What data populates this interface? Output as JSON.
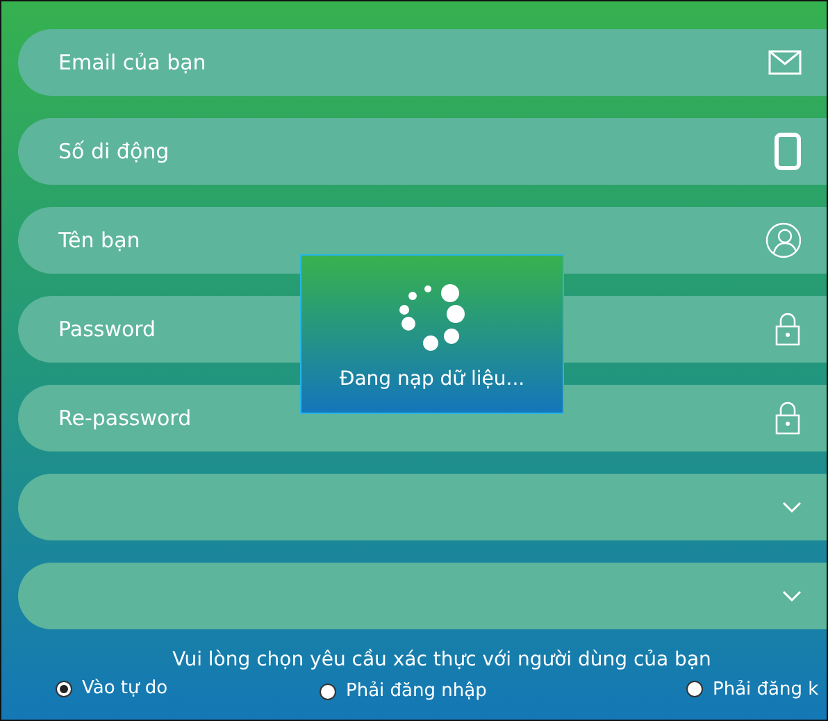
{
  "fields": [
    {
      "kind": "text",
      "placeholder": "Email của bạn"
    },
    {
      "kind": "text",
      "placeholder": "Số di động"
    },
    {
      "kind": "text",
      "placeholder": "Tên bạn"
    },
    {
      "kind": "text",
      "placeholder": "Password"
    },
    {
      "kind": "text",
      "placeholder": "Re-password"
    },
    {
      "kind": "select"
    },
    {
      "kind": "select"
    }
  ],
  "prompt": "Vui lòng chọn yêu cầu xác thực với người dùng của bạn",
  "options": [
    {
      "label": "Vào tự do",
      "selected": true
    },
    {
      "label": "Phải đăng nhập",
      "selected": false
    },
    {
      "label": "Phải đăng k",
      "selected": false
    }
  ],
  "loading": {
    "message": "Đang nạp dữ liệu..."
  }
}
